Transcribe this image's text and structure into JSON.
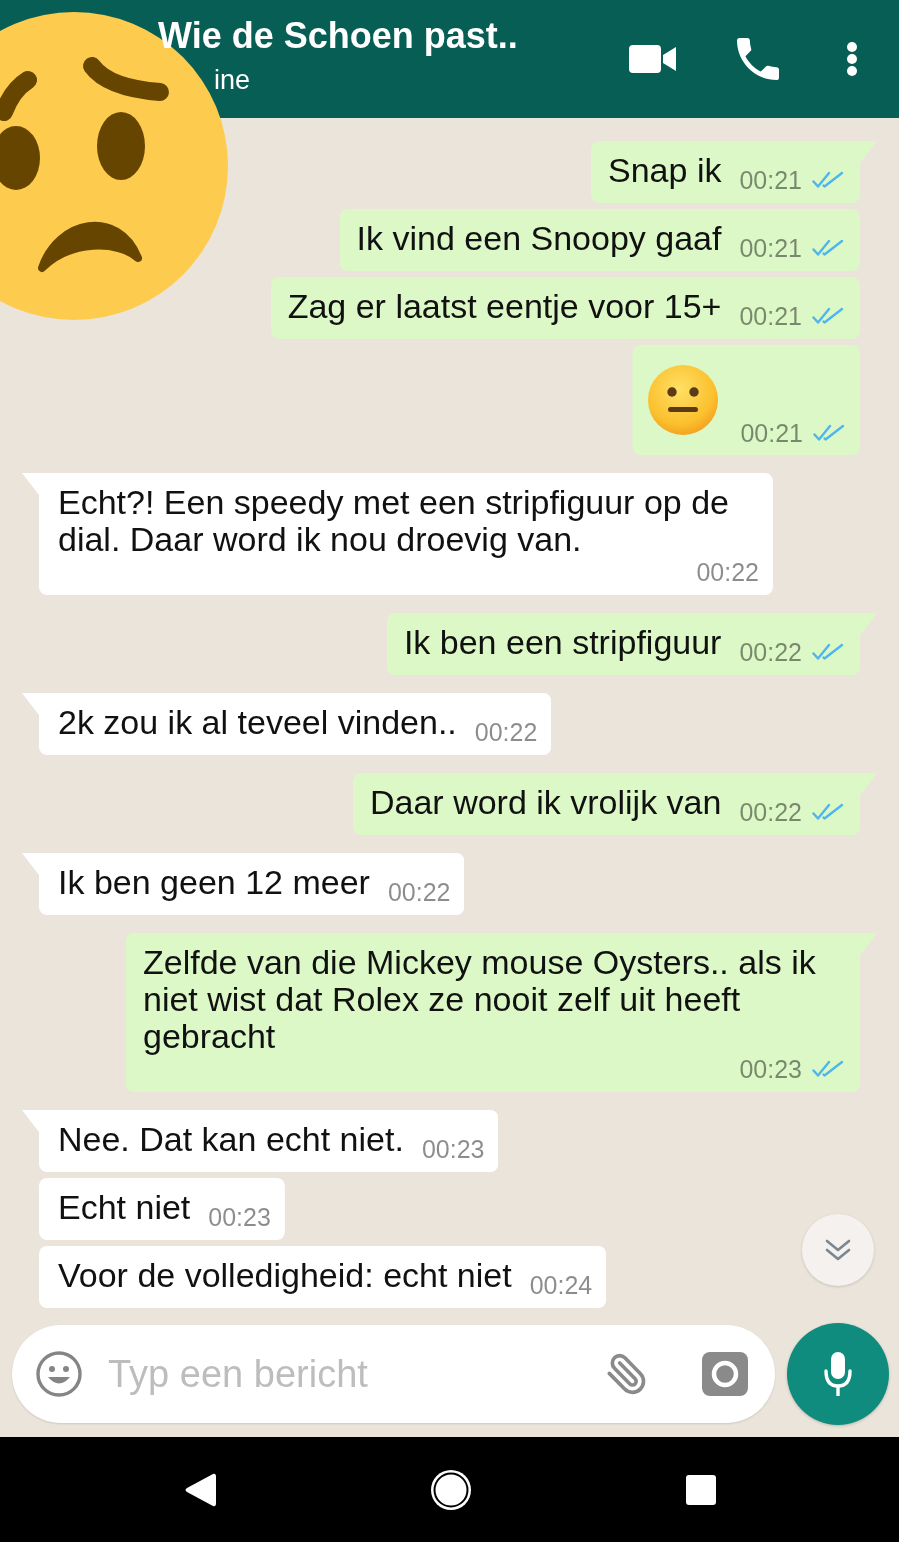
{
  "header": {
    "title": "Wie de Schoen past..",
    "status": "ine"
  },
  "messages": [
    {
      "kind": "text",
      "outgoing": true,
      "tail": true,
      "text": "Snap ik",
      "time": "00:21",
      "read": true
    },
    {
      "kind": "text",
      "outgoing": true,
      "tail": false,
      "text": "Ik vind een Snoopy gaaf",
      "time": "00:21",
      "read": true
    },
    {
      "kind": "text",
      "outgoing": true,
      "tail": false,
      "text": "Zag er laatst eentje voor 15+",
      "time": "00:21",
      "read": true
    },
    {
      "kind": "emoji",
      "outgoing": true,
      "tail": false,
      "time": "00:21",
      "read": true
    },
    {
      "kind": "text",
      "outgoing": false,
      "tail": true,
      "text": "Echt?! Een speedy met een stripfiguur op de dial. Daar word ik nou droevig van.",
      "time": "00:22"
    },
    {
      "kind": "text",
      "outgoing": true,
      "tail": true,
      "text": "Ik ben een stripfiguur",
      "time": "00:22",
      "read": true
    },
    {
      "kind": "text",
      "outgoing": false,
      "tail": true,
      "text": "2k zou ik al teveel vinden..",
      "time": "00:22"
    },
    {
      "kind": "text",
      "outgoing": true,
      "tail": true,
      "text": "Daar word ik vrolijk van",
      "time": "00:22",
      "read": true
    },
    {
      "kind": "text",
      "outgoing": false,
      "tail": true,
      "text": "Ik ben geen 12 meer",
      "time": "00:22"
    },
    {
      "kind": "text",
      "outgoing": true,
      "tail": true,
      "text": "Zelfde van die Mickey mouse Oysters.. als ik niet wist dat Rolex ze nooit zelf uit heeft gebracht",
      "time": "00:23",
      "read": true
    },
    {
      "kind": "text",
      "outgoing": false,
      "tail": true,
      "text": "Nee. Dat kan echt niet.",
      "time": "00:23"
    },
    {
      "kind": "text",
      "outgoing": false,
      "tail": false,
      "text": "Echt niet",
      "time": "00:23"
    },
    {
      "kind": "text",
      "outgoing": false,
      "tail": false,
      "text": "Voor de volledigheid: echt niet",
      "time": "00:24"
    }
  ],
  "composer": {
    "placeholder": "Typ een bericht"
  }
}
